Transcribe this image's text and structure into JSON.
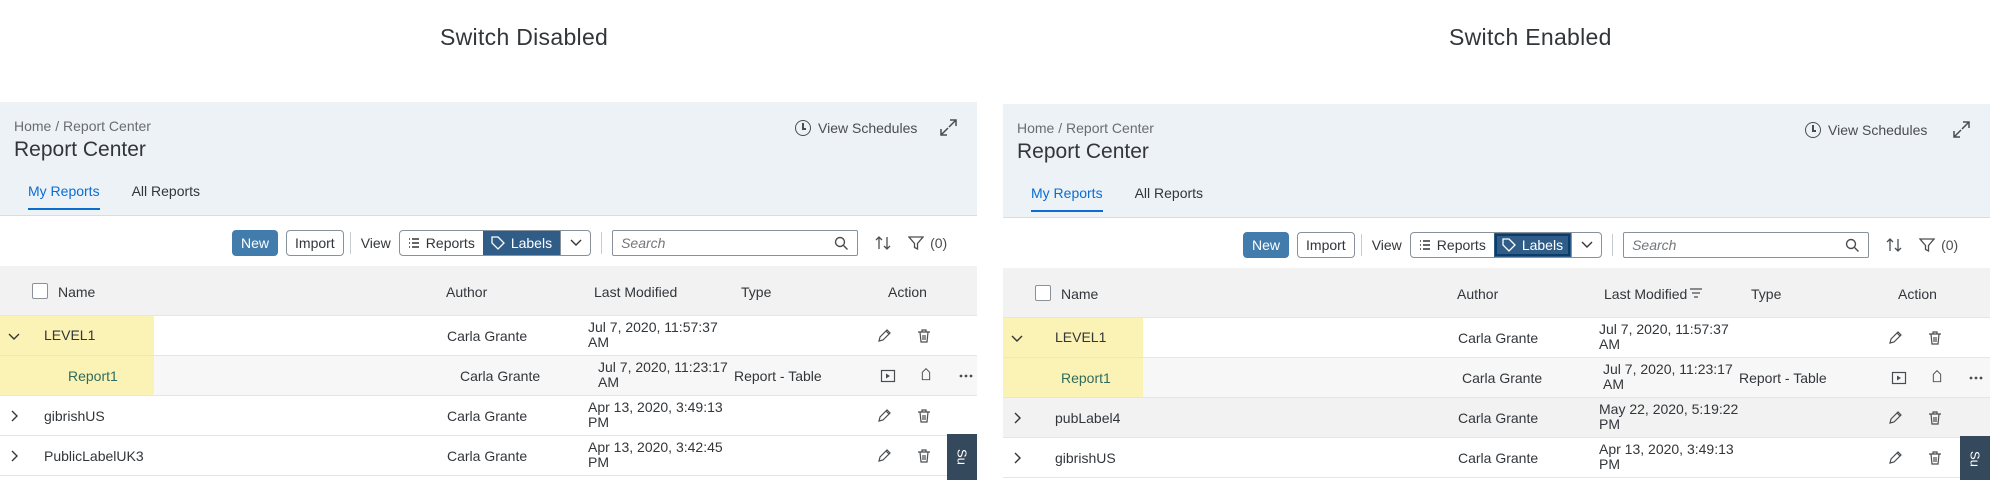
{
  "captions": {
    "left": "Switch Disabled",
    "right": "Switch Enabled"
  },
  "panels": {
    "breadcrumb": "Home / Report Center",
    "title": "Report Center",
    "view_schedules": "View Schedules",
    "tabs": [
      "My Reports",
      "All Reports"
    ],
    "toolbar": {
      "new": "New",
      "import": "Import",
      "view": "View",
      "reports": "Reports",
      "labels": "Labels",
      "search_placeholder": "Search",
      "filter_count": "(0)"
    },
    "columns": {
      "name": "Name",
      "author": "Author",
      "last_modified": "Last Modified",
      "type": "Type",
      "action": "Action"
    },
    "side_tab": "Su"
  },
  "left_rows": [
    {
      "name": "LEVEL1",
      "author": "Carla Grante",
      "date1": "Jul 7, 2020, 11:57:37",
      "date2": "AM",
      "type": ""
    },
    {
      "name": "Report1",
      "author": "Carla Grante",
      "date1": "Jul 7, 2020, 11:23:17",
      "date2": "AM",
      "type": "Report - Table"
    },
    {
      "name": "gibrishUS",
      "author": "Carla Grante",
      "date1": "Apr 13, 2020, 3:49:13",
      "date2": "PM",
      "type": ""
    },
    {
      "name": "PublicLabelUK3",
      "author": "Carla Grante",
      "date1": "Apr 13, 2020, 3:42:45",
      "date2": "PM",
      "type": ""
    }
  ],
  "right_rows": [
    {
      "name": "LEVEL1",
      "author": "Carla Grante",
      "date1": "Jul 7, 2020, 11:57:37",
      "date2": "AM",
      "type": ""
    },
    {
      "name": "Report1",
      "author": "Carla Grante",
      "date1": "Jul 7, 2020, 11:23:17",
      "date2": "AM",
      "type": "Report - Table"
    },
    {
      "name": "pubLabel4",
      "author": "Carla Grante",
      "date1": "May 22, 2020, 5:19:22",
      "date2": "PM",
      "type": ""
    },
    {
      "name": "gibrishUS",
      "author": "Carla Grante",
      "date1": "Apr 13, 2020, 3:49:13",
      "date2": "PM",
      "type": ""
    }
  ],
  "colors": {
    "accent": "#0a6ed1",
    "header_bg": "#edf2f7",
    "highlight": "#fbf2b5",
    "selected_segment": "#2f5d87"
  }
}
